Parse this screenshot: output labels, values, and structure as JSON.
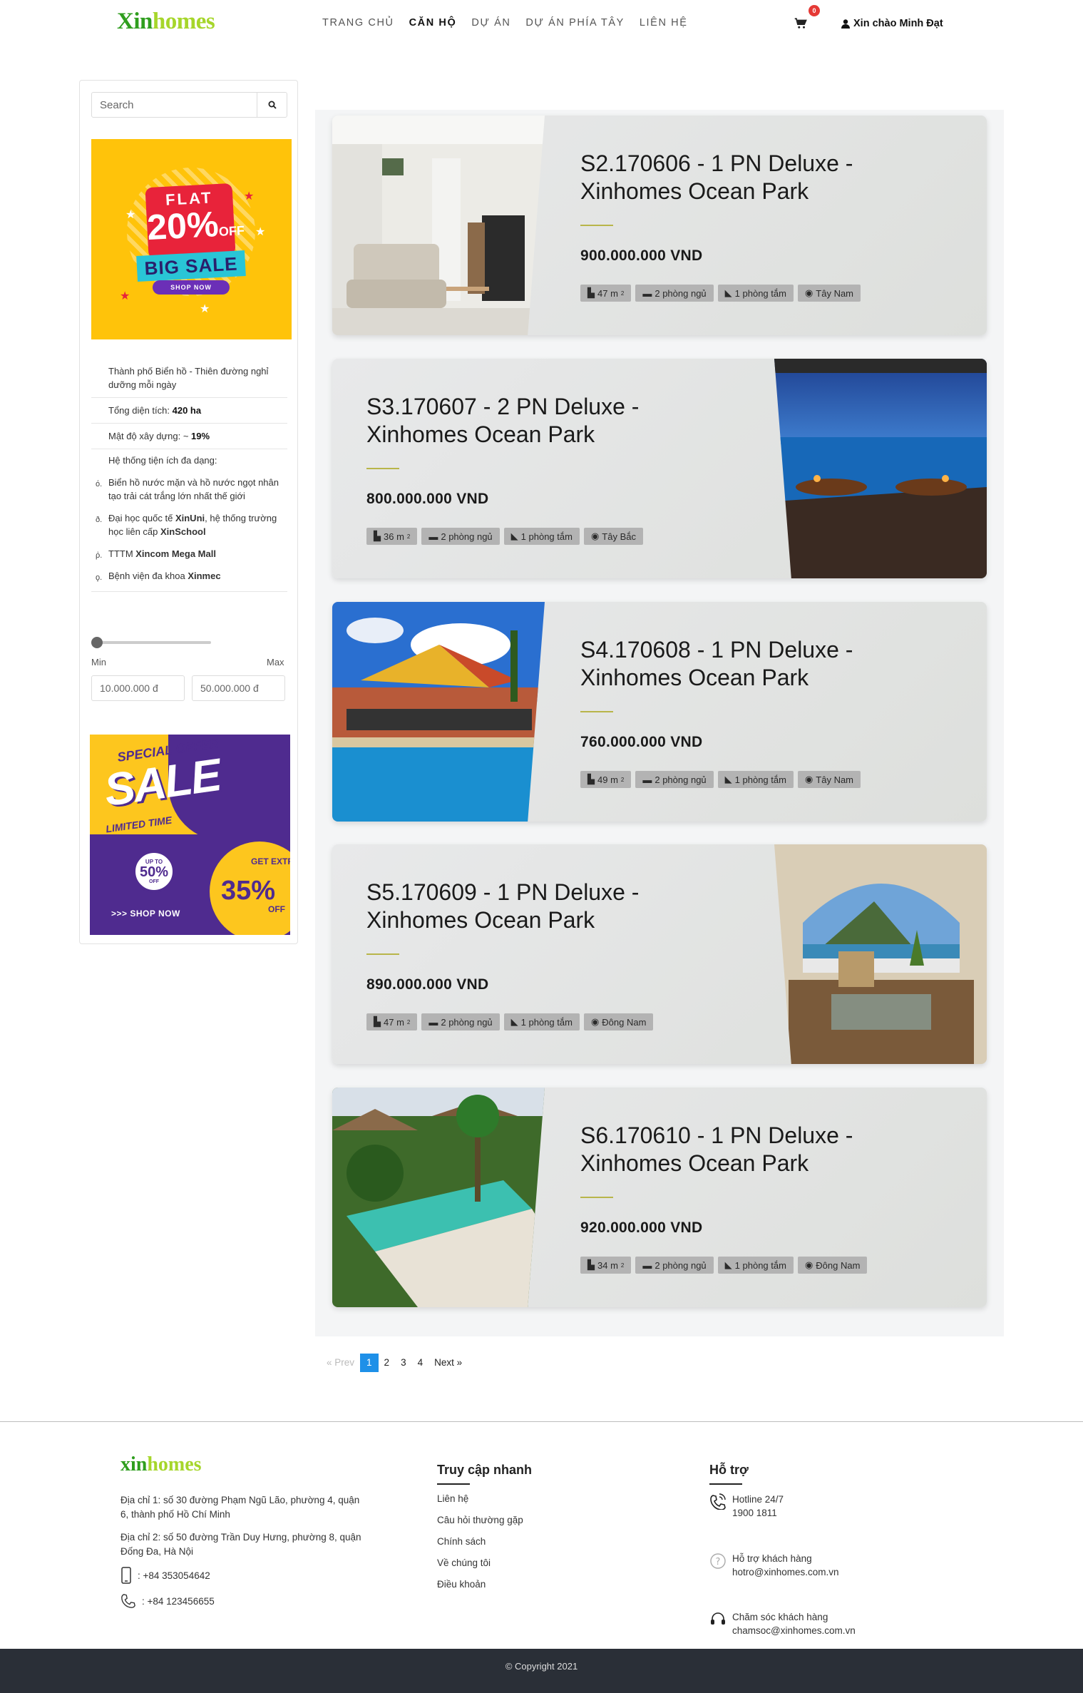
{
  "header": {
    "logo_part1": "Xin",
    "logo_part2": "homes",
    "nav": [
      "TRANG CHỦ",
      "CĂN HỘ",
      "DỰ ÁN",
      "DỰ ÁN PHÍA TÂY",
      "LIÊN HỆ"
    ],
    "active_nav": "CĂN HỘ",
    "cart_count": "0",
    "greeting": "Xin chào Minh Đạt"
  },
  "sidebar": {
    "search_placeholder": "Search",
    "banner1": {
      "flat": "FLAT",
      "percent": "20%",
      "off": "OFF",
      "big_sale": "BIG SALE",
      "shop_now": "SHOP NOW"
    },
    "features": {
      "intro": "Thành phố Biển hồ - Thiên đường nghỉ dưỡng mỗi ngày",
      "area_label": "Tổng diện tích: ",
      "area_value": "420 ha",
      "density_label": "Mật độ xây dựng: ~ ",
      "density_value": "19%",
      "amenities_title": "Hệ thống tiện ích đa dạng:",
      "amenities": [
        {
          "num": "ό.",
          "text": "Biển hồ nước mặn và hồ nước ngọt nhân tạo trải cát trắng lớn nhất thế giới"
        },
        {
          "num": "ð.",
          "text_pre": "Đại học quốc tế ",
          "b1": "XinUni",
          "text_mid": ", hệ thống trường học liên cấp ",
          "b2": "XinSchool"
        },
        {
          "num": "ῤ.",
          "text_pre": "TTTM ",
          "b1": "Xincom Mega Mall"
        },
        {
          "num": "ϙ.",
          "text_pre": "Bệnh viện đa khoa ",
          "b1": "Xinmec"
        }
      ]
    },
    "price_filter": {
      "min_label": "Min",
      "max_label": "Max",
      "min_value": "10.000.000 đ",
      "max_value": "50.000.000 đ",
      "slider_position": 0
    },
    "banner2": {
      "special_offer": "SPECIAL OFFER",
      "sale": "SALE",
      "limited_time": "LIMITED TIME",
      "up_to": "UP TO",
      "up_to_percent": "50%",
      "up_to_off": "OFF",
      "get_extra": "GET EXTRA",
      "extra_percent": "35%",
      "extra_off": "OFF",
      "shop_now": "SHOP NOW"
    }
  },
  "listings": [
    {
      "title": "S2.170606 - 1 PN Deluxe - Xinhomes Ocean Park",
      "price": "900.000.000 VND",
      "area": "47 m",
      "bedrooms": "2 phòng ngủ",
      "bathrooms": "1 phòng tắm",
      "direction": "Tây Nam",
      "image": "interior-living-room",
      "layout": "left"
    },
    {
      "title": "S3.170607 - 2 PN Deluxe - Xinhomes Ocean Park",
      "price": "800.000.000 VND",
      "area": "36 m",
      "bedrooms": "2 phòng ngủ",
      "bathrooms": "1 phòng tắm",
      "direction": "Tây Bắc",
      "image": "ocean-terrace",
      "layout": "right"
    },
    {
      "title": "S4.170608 - 1 PN Deluxe - Xinhomes Ocean Park",
      "price": "760.000.000 VND",
      "area": "49 m",
      "bedrooms": "2 phòng ngủ",
      "bathrooms": "1 phòng tắm",
      "direction": "Tây Nam",
      "image": "resort-pool",
      "layout": "left"
    },
    {
      "title": "S5.170609 - 1 PN Deluxe - Xinhomes Ocean Park",
      "price": "890.000.000 VND",
      "area": "47 m",
      "bedrooms": "2 phòng ngủ",
      "bathrooms": "1 phòng tắm",
      "direction": "Đông Nam",
      "image": "balcony-sea-view",
      "layout": "right"
    },
    {
      "title": "S6.170610 - 1 PN Deluxe - Xinhomes Ocean Park",
      "price": "920.000.000 VND",
      "area": "34 m",
      "bedrooms": "2 phòng ngủ",
      "bathrooms": "1 phòng tắm",
      "direction": "Đông Nam",
      "image": "villa-pool-aerial",
      "layout": "left"
    }
  ],
  "area_unit_sup": "2",
  "pagination": {
    "prev": "Prev",
    "pages": [
      "1",
      "2",
      "3",
      "4"
    ],
    "current": "1",
    "next": "Next"
  },
  "footer": {
    "logo_part1": "xin",
    "logo_part2": "homes",
    "address1": "Địa chỉ 1: số 30 đường Phạm Ngũ Lão, phường 4, quận 6, thành phố Hồ Chí Minh",
    "address2": "Địa chỉ 2: số 50 đường Trần Duy Hưng, phường 8, quận Đống Đa, Hà Nội",
    "mobile": ": +84 353054642",
    "phone": ": +84 123456655",
    "quick_title": "Truy cập nhanh",
    "quick_links": [
      "Liên hệ",
      "Câu hỏi thường gặp",
      "Chính sách",
      "Về chúng tôi",
      "Điều khoản"
    ],
    "support_title": "Hỗ trợ",
    "support": [
      {
        "label": "Hotline 24/7",
        "value": "1900 1811"
      },
      {
        "label": "Hỗ trợ khách hàng",
        "value": "hotro@xinhomes.com.vn"
      },
      {
        "label": "Chăm sóc khách hàng",
        "value": "chamsoc@xinhomes.com.vn"
      }
    ],
    "copyright": "© Copyright 2021"
  }
}
